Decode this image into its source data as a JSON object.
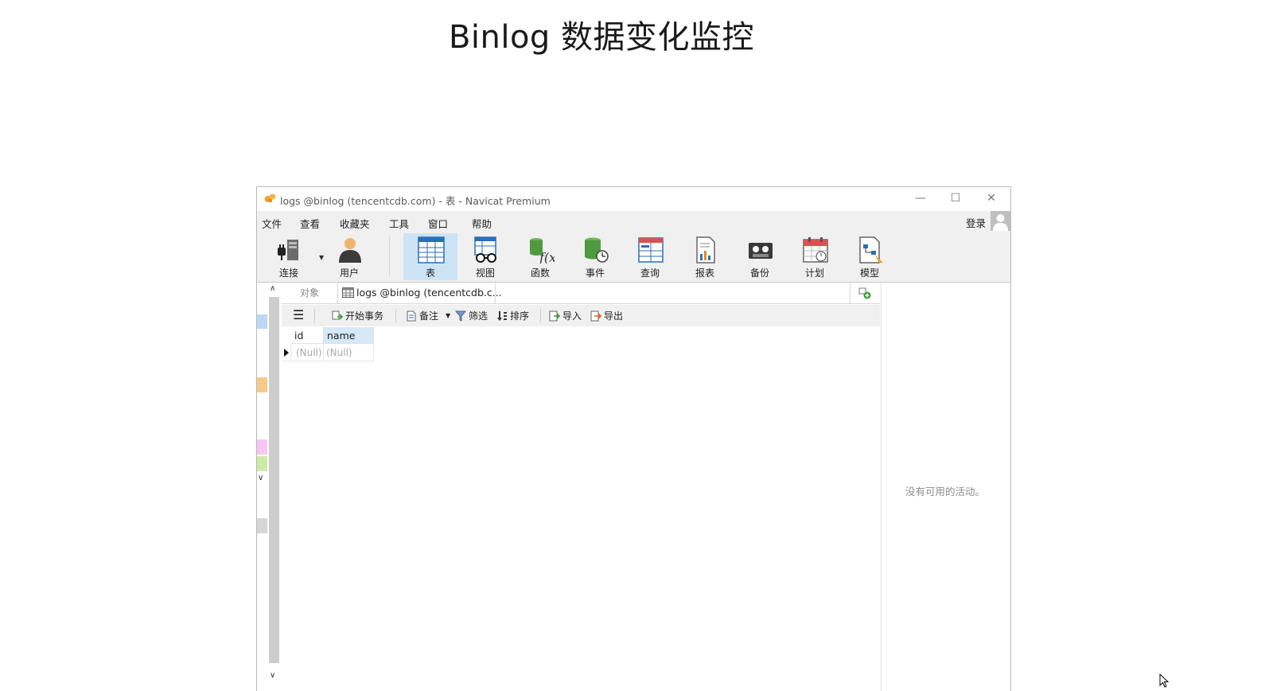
{
  "page": {
    "title": "Binlog 数据变化监控"
  },
  "window": {
    "title": "logs @binlog (tencentcdb.com) - 表 - Navicat Premium",
    "controls": {
      "minimize": "—",
      "maximize": "☐",
      "close": "✕"
    }
  },
  "menu": {
    "items": [
      "文件",
      "查看",
      "收藏夹",
      "工具",
      "窗口",
      "帮助"
    ],
    "login": "登录"
  },
  "ribbon": {
    "buttons": [
      {
        "label": "连接",
        "icon": "connection-icon"
      },
      {
        "label": "用户",
        "icon": "user-icon"
      },
      {
        "label": "表",
        "icon": "table-icon",
        "active": true
      },
      {
        "label": "视图",
        "icon": "view-icon"
      },
      {
        "label": "函数",
        "icon": "function-icon"
      },
      {
        "label": "事件",
        "icon": "event-icon"
      },
      {
        "label": "查询",
        "icon": "query-icon"
      },
      {
        "label": "报表",
        "icon": "report-icon"
      },
      {
        "label": "备份",
        "icon": "backup-icon"
      },
      {
        "label": "计划",
        "icon": "schedule-icon"
      },
      {
        "label": "模型",
        "icon": "model-icon"
      }
    ]
  },
  "tabs": {
    "objects": "对象",
    "active_tab": "logs @binlog (tencentcdb.c..."
  },
  "subtoolbar": {
    "begin_transaction": "开始事务",
    "comment": "备注",
    "filter": "筛选",
    "sort": "排序",
    "import": "导入",
    "export": "导出"
  },
  "grid": {
    "columns": [
      "id",
      "name"
    ],
    "rows": [
      [
        "(Null)",
        "(Null)"
      ]
    ]
  },
  "activity": {
    "empty_text": "没有可用的活动。"
  },
  "colors": {
    "accent": "#cde4f7",
    "header_selected": "#d7e9f7",
    "toolbar_bg": "#f0f0f0"
  }
}
